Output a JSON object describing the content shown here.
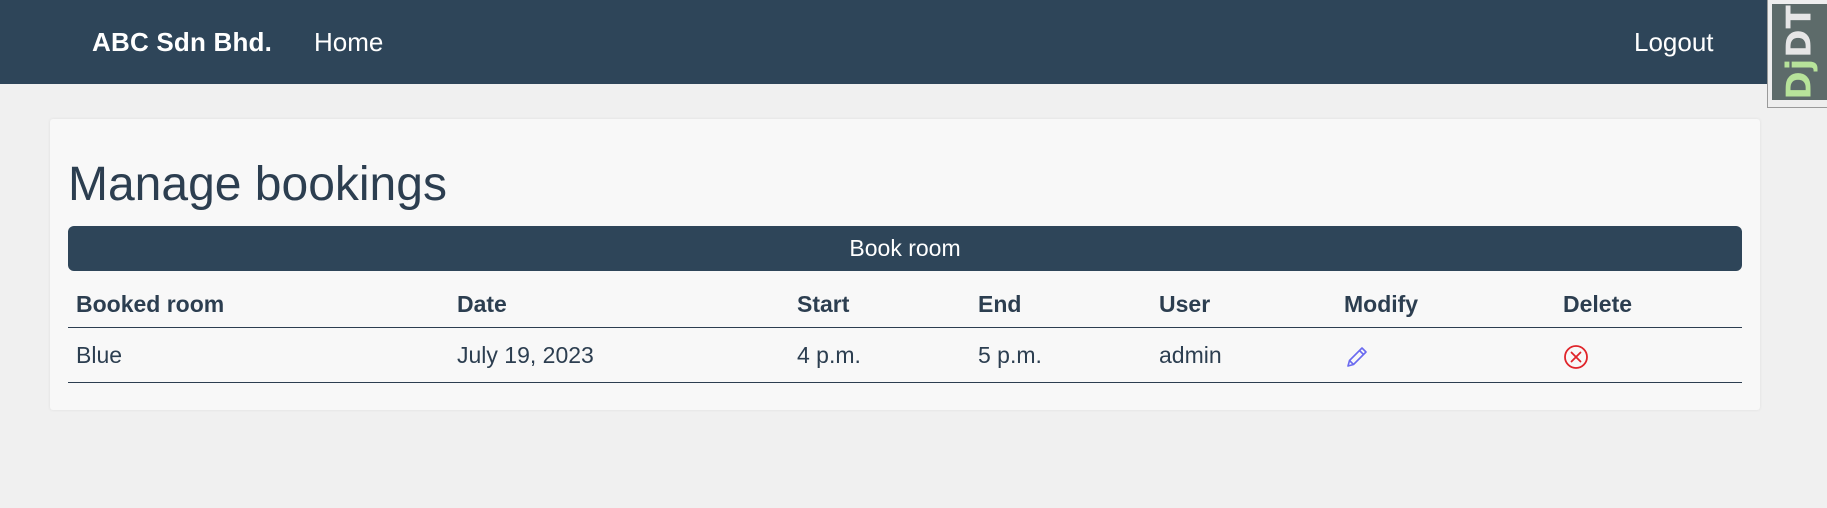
{
  "navbar": {
    "brand": "ABC Sdn Bhd.",
    "home_label": "Home",
    "logout_label": "Logout",
    "background": "#2e4559"
  },
  "debug_toolbar": {
    "label_dj": "Dj",
    "label_dt": "DT"
  },
  "main": {
    "title": "Manage bookings",
    "book_button_label": "Book room",
    "table": {
      "headers": [
        "Booked room",
        "Date",
        "Start",
        "End",
        "User",
        "Modify",
        "Delete"
      ],
      "rows": [
        {
          "room": "Blue",
          "date": "July 19, 2023",
          "start": "4 p.m.",
          "end": "5 p.m.",
          "user": "admin",
          "modify_icon": "pencil-icon",
          "delete_icon": "circle-x-icon"
        }
      ]
    }
  },
  "colors": {
    "accent": "#2e4559",
    "text": "#2c3e50",
    "edit_icon": "#6a6af0",
    "delete_icon": "#e0242a"
  }
}
